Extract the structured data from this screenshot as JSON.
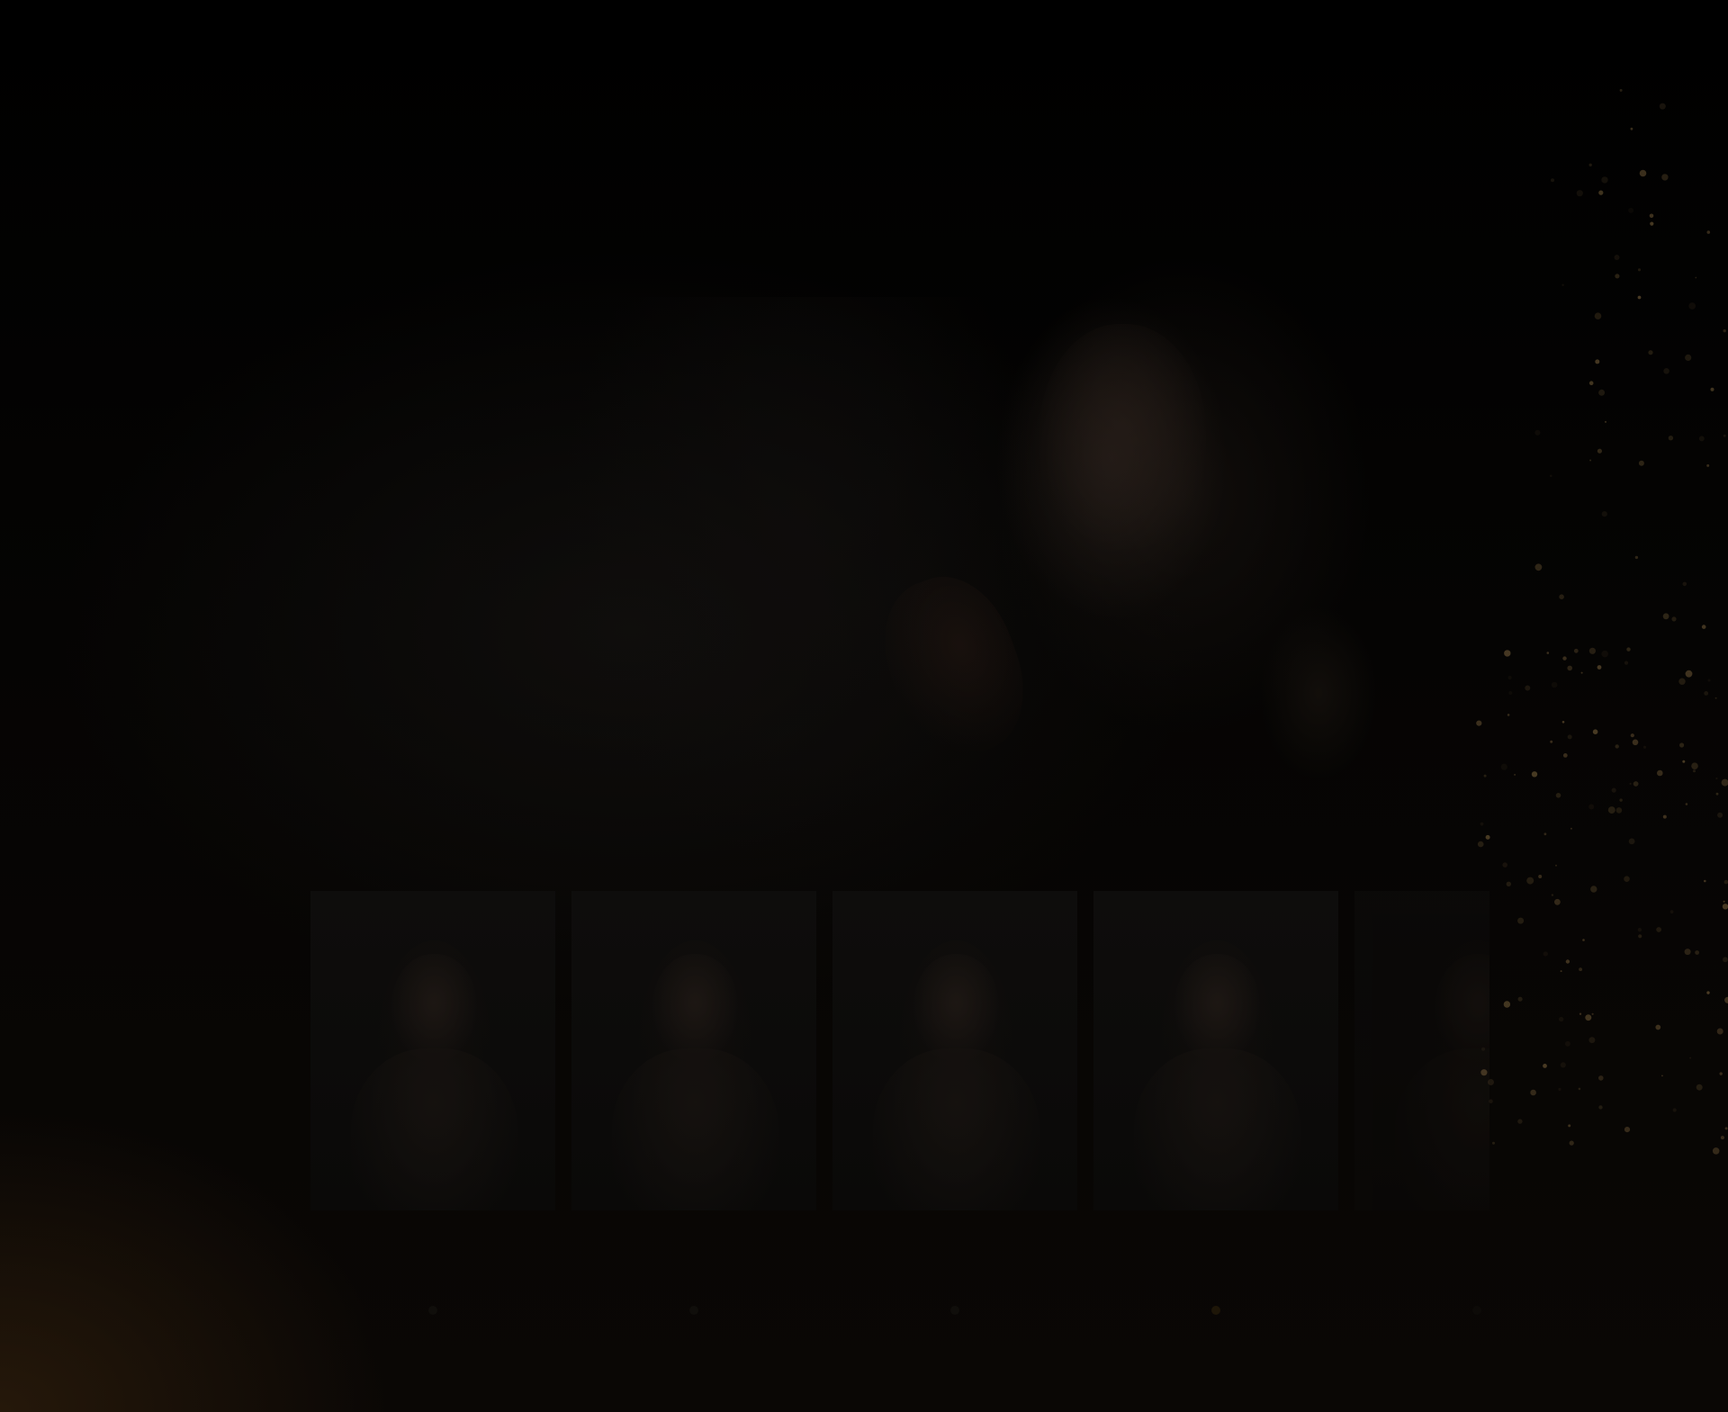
{
  "hero": {
    "title": "",
    "description": ""
  },
  "cast": [
    {
      "name": "",
      "role": "",
      "active": false
    },
    {
      "name": "",
      "role": "",
      "active": false
    },
    {
      "name": "",
      "role": "",
      "active": false
    },
    {
      "name": "",
      "role": "",
      "active": true
    },
    {
      "name": "",
      "role": "",
      "active": false
    }
  ],
  "colors": {
    "background": "#000000",
    "accent_glow": "#3c260e",
    "sparkle": "#c8a060",
    "active_dot": "#1e1608"
  }
}
